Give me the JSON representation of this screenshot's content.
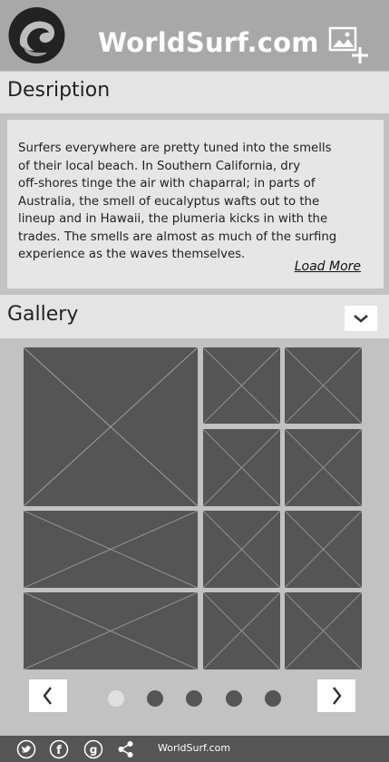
{
  "header": {
    "title": "WorldSurf.com",
    "logo_icon": "wave-logo-icon",
    "add_image_icon": "add-image-icon"
  },
  "description": {
    "title": "Desription",
    "text": "Surfers everywhere are pretty tuned into the smells\n of their local beach. In Southern California, dry\noff-shores tinge the air with chaparral; in parts of\n Australia, the smell of eucalyptus wafts out to the\nlineup and in Hawaii, the plumeria kicks in with the\n trades. The smells are almost as much of the surfing\nexperience as the waves themselves.",
    "load_more_label": "Load More"
  },
  "gallery": {
    "title": "Gallery",
    "dropdown_icon": "chevron-down-icon",
    "image_count": 11,
    "prev_icon": "chevron-left-icon",
    "next_icon": "chevron-right-icon",
    "page_count": 5,
    "active_page": 1
  },
  "footer": {
    "text": "WorldSurf.com",
    "icons": [
      "twitter-icon",
      "facebook-icon",
      "google-plus-icon",
      "share-icon"
    ]
  },
  "colors": {
    "header_bg": "#a8a8a8",
    "page_bg": "#c2c2c2",
    "tile_bg": "#555555",
    "footer_bg": "#555555"
  }
}
